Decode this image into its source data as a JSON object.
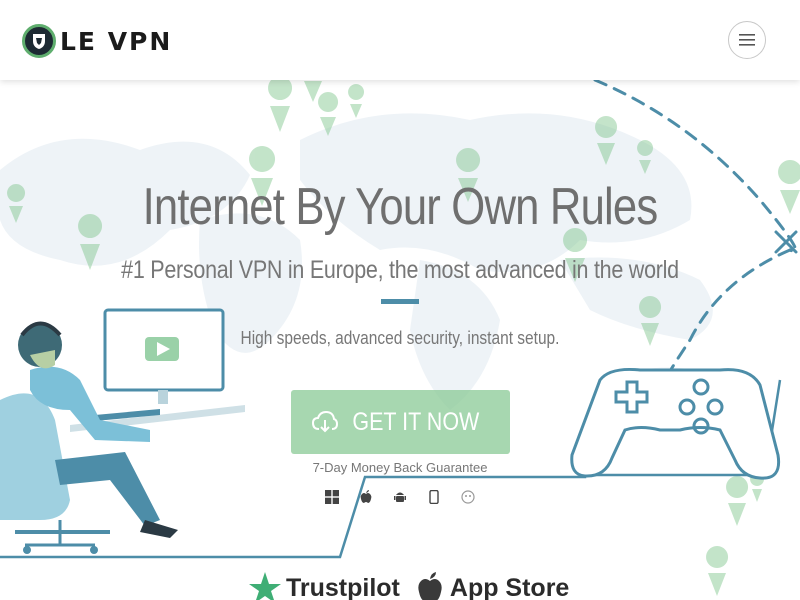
{
  "brand": {
    "name": "LE VPN"
  },
  "header": {
    "menu_icon": "hamburger-icon"
  },
  "hero": {
    "title": "Internet By Your Own Rules",
    "subtitle": "#1 Personal VPN in Europe, the most advanced in the world",
    "tagline": "High speeds, advanced security, instant setup.",
    "cta": {
      "label": "GET IT NOW",
      "icon": "cloud-download-icon"
    },
    "guarantee": "7-Day Money Back Guarantee",
    "platforms": [
      "windows-icon",
      "apple-icon",
      "android-icon",
      "mobile-icon",
      "linux-icon"
    ]
  },
  "badges": {
    "trustpilot": "Trustpilot",
    "appstore": "App Store"
  },
  "colors": {
    "accent": "#4d8da8",
    "cta": "#8ac995",
    "green": "#5fae6e",
    "pin": "#7cc48a"
  }
}
